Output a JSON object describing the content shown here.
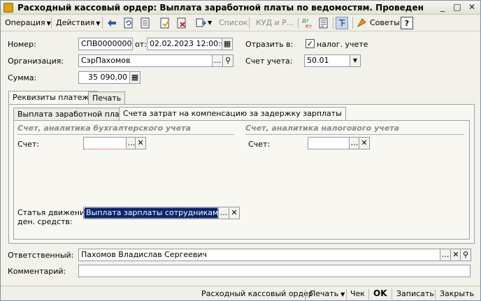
{
  "window": {
    "title": "Расходный кассовый ордер: Выплата заработной платы по ведомостям. Проведен"
  },
  "toolbar": {
    "operation": "Операция",
    "actions": "Действия",
    "list": "Список",
    "kudir": "КУД и Р...",
    "advice": "Советы",
    "help": "?"
  },
  "form": {
    "number_label": "Номер:",
    "number_value": "СПВ00000001",
    "date_label": "от:",
    "date_value": "02.02.2023 12:00:00",
    "reflect_label": "Отразить в:",
    "tax_check_label": "налог. учете",
    "tax_checked": true,
    "org_label": "Организация:",
    "org_value": "СэрПахомов",
    "account_label": "Счет учета:",
    "account_value": "50.01",
    "sum_label": "Сумма:",
    "sum_value": "35 090,00"
  },
  "tabs": [
    {
      "label": "Реквизиты платежа"
    },
    {
      "label": "Печать"
    }
  ],
  "subtabs": [
    {
      "label": "Выплата заработной платы"
    },
    {
      "label": "Счета затрат на компенсацию за задержку зарплаты"
    }
  ],
  "groups": {
    "accounting": "Счет, аналитика бухгалтерского учета",
    "tax": "Счет, аналитика налогового учета"
  },
  "fields": {
    "account_left_label": "Счет:",
    "account_left_value": "",
    "account_right_label": "Счет:",
    "account_right_value": "",
    "cashflow_label_1": "Статья движения",
    "cashflow_label_2": "ден. средств:",
    "cashflow_value": "Выплата зарплаты сотрудникам"
  },
  "responsible": {
    "label": "Ответственный:",
    "value": "Пахомов Владислав Сергеевич"
  },
  "comment": {
    "label": "Комментарий:",
    "value": ""
  },
  "bottom": {
    "order": "Расходный кассовый ордер",
    "print": "Печать",
    "check": "Чек",
    "ok": "OK",
    "save": "Записать",
    "close": "Закрыть"
  }
}
